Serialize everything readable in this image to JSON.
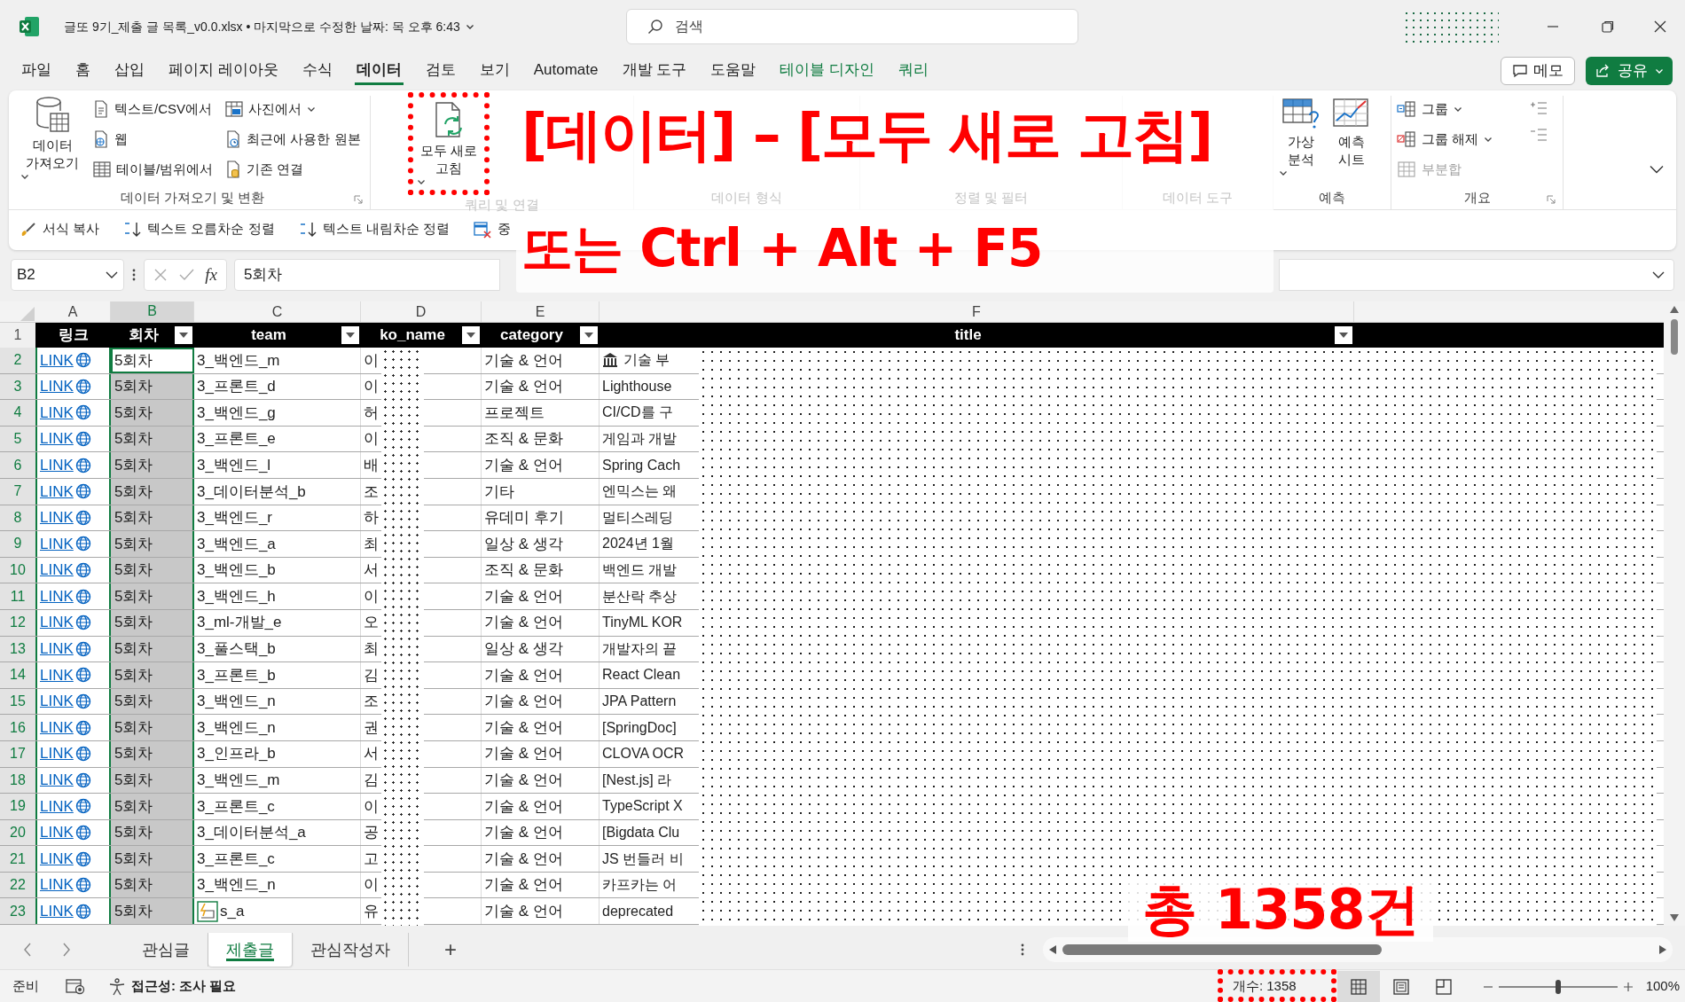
{
  "window": {
    "title": "글또 9기_제출 글 목록_v0.0.xlsx • 마지막으로 수정한 날짜: 목 오후 6:43",
    "search": {
      "placeholder": "검색"
    }
  },
  "menu_tabs": [
    {
      "label": "파일",
      "selected": false,
      "kind": "normal"
    },
    {
      "label": "홈",
      "selected": false,
      "kind": "normal"
    },
    {
      "label": "삽입",
      "selected": false,
      "kind": "normal"
    },
    {
      "label": "페이지 레이아웃",
      "selected": false,
      "kind": "normal"
    },
    {
      "label": "수식",
      "selected": false,
      "kind": "normal"
    },
    {
      "label": "데이터",
      "selected": true,
      "kind": "normal"
    },
    {
      "label": "검토",
      "selected": false,
      "kind": "normal"
    },
    {
      "label": "보기",
      "selected": false,
      "kind": "normal"
    },
    {
      "label": "Automate",
      "selected": false,
      "kind": "normal"
    },
    {
      "label": "개발 도구",
      "selected": false,
      "kind": "normal"
    },
    {
      "label": "도움말",
      "selected": false,
      "kind": "normal"
    },
    {
      "label": "테이블 디자인",
      "selected": false,
      "kind": "contextual"
    },
    {
      "label": "쿼리",
      "selected": false,
      "kind": "contextual"
    }
  ],
  "header_buttons": [
    {
      "label": "메모",
      "kind": "outline"
    },
    {
      "label": "공유",
      "kind": "primary"
    }
  ],
  "ribbon": {
    "groups": [
      {
        "label": "데이터 가져오기 및 변환",
        "faded": false,
        "items": [
          {
            "kind": "large",
            "label": "데이터 가져오기",
            "dropdown": true,
            "disabled": false
          },
          {
            "kind": "small",
            "label": "텍스트/CSV에서",
            "dropdown": false,
            "disabled": false
          },
          {
            "kind": "small",
            "label": "웹",
            "dropdown": false,
            "disabled": false
          },
          {
            "kind": "small",
            "label": "테이블/범위에서",
            "dropdown": false,
            "disabled": false
          },
          {
            "kind": "small",
            "label": "사진에서",
            "dropdown": true,
            "disabled": false
          },
          {
            "kind": "small",
            "label": "최근에 사용한 원본",
            "dropdown": false,
            "disabled": false
          },
          {
            "kind": "small",
            "label": "기존 연결",
            "dropdown": false,
            "disabled": false
          }
        ]
      },
      {
        "label": "쿼리 및 연결",
        "faded": true,
        "items": [
          {
            "kind": "large",
            "label": "모두 새로 고침",
            "dropdown": true,
            "disabled": false
          }
        ]
      },
      {
        "label": "데이터 형식",
        "faded": true
      },
      {
        "label": "정렬 및 필터",
        "faded": true
      },
      {
        "label": "데이터 도구",
        "faded": true
      },
      {
        "label": "예측",
        "faded": false,
        "items": [
          {
            "kind": "large",
            "label": "가상 분석",
            "dropdown": true,
            "disabled": false
          },
          {
            "kind": "large",
            "label": "예측 시트",
            "dropdown": false,
            "disabled": false
          }
        ]
      },
      {
        "label": "개요",
        "faded": false,
        "items": [
          {
            "kind": "small",
            "label": "그룹",
            "dropdown": true,
            "disabled": false
          },
          {
            "kind": "small",
            "label": "그룹 해제",
            "dropdown": true,
            "disabled": false
          },
          {
            "kind": "small",
            "label": "부분합",
            "dropdown": false,
            "disabled": true
          }
        ]
      }
    ]
  },
  "quick_toolbar": [
    {
      "label": "서식 복사"
    },
    {
      "label": "텍스트 오름차순 정렬"
    },
    {
      "label": "텍스트 내림차순 정렬"
    },
    {
      "label": "중"
    }
  ],
  "formula_bar": {
    "name_box": "B2",
    "function_label": "fx",
    "value": "5회차"
  },
  "columns": [
    {
      "letter": "A",
      "selected": false
    },
    {
      "letter": "B",
      "selected": true
    },
    {
      "letter": "C",
      "selected": false
    },
    {
      "letter": "D",
      "selected": false
    },
    {
      "letter": "E",
      "selected": false
    },
    {
      "letter": "F",
      "selected": false
    }
  ],
  "table": {
    "header_row_number": "1",
    "header": [
      {
        "label": "링크",
        "filter": false
      },
      {
        "label": "회차",
        "filter": true
      },
      {
        "label": "team",
        "filter": true
      },
      {
        "label": "ko_name",
        "filter": true
      },
      {
        "label": "category",
        "filter": true
      },
      {
        "label": "title",
        "filter": true
      }
    ],
    "rows": [
      {
        "number": "2",
        "link": "LINK",
        "round": "5회차",
        "team": "3_백엔드_m",
        "ko_name": "이",
        "category": "기술 & 언어",
        "title": "기술 부",
        "title_icon": true,
        "selected": true,
        "active": true
      },
      {
        "number": "3",
        "link": "LINK",
        "round": "5회차",
        "team": "3_프론트_d",
        "ko_name": "이",
        "category": "기술 & 언어",
        "title": "Lighthouse",
        "selected": true,
        "active": false
      },
      {
        "number": "4",
        "link": "LINK",
        "round": "5회차",
        "team": "3_백엔드_g",
        "ko_name": "허",
        "category": "프로젝트",
        "title": "CI/CD를 구",
        "selected": true,
        "active": false
      },
      {
        "number": "5",
        "link": "LINK",
        "round": "5회차",
        "team": "3_프론트_e",
        "ko_name": "이",
        "category": "조직 & 문화",
        "title": "게임과 개발",
        "selected": true,
        "active": false
      },
      {
        "number": "6",
        "link": "LINK",
        "round": "5회차",
        "team": "3_백엔드_l",
        "ko_name": "배",
        "category": "기술 & 언어",
        "title": "Spring Cach",
        "selected": true,
        "active": false
      },
      {
        "number": "7",
        "link": "LINK",
        "round": "5회차",
        "team": "3_데이터분석_b",
        "ko_name": "조",
        "category": "기타",
        "title": "엔믹스는 왜",
        "selected": true,
        "active": false
      },
      {
        "number": "8",
        "link": "LINK",
        "round": "5회차",
        "team": "3_백엔드_r",
        "ko_name": "하",
        "category": "유데미 후기",
        "title": "멀티스레딩",
        "selected": true,
        "active": false
      },
      {
        "number": "9",
        "link": "LINK",
        "round": "5회차",
        "team": "3_백엔드_a",
        "ko_name": "최",
        "category": "일상 & 생각",
        "title": "2024년 1월",
        "selected": true,
        "active": false
      },
      {
        "number": "10",
        "link": "LINK",
        "round": "5회차",
        "team": "3_백엔드_b",
        "ko_name": "서",
        "category": "조직 & 문화",
        "title": "백엔드 개발",
        "selected": true,
        "active": false
      },
      {
        "number": "11",
        "link": "LINK",
        "round": "5회차",
        "team": "3_백엔드_h",
        "ko_name": "이",
        "category": "기술 & 언어",
        "title": "분산락 추상",
        "selected": true,
        "active": false
      },
      {
        "number": "12",
        "link": "LINK",
        "round": "5회차",
        "team": "3_ml-개발_e",
        "ko_name": "오",
        "category": "기술 & 언어",
        "title": "TinyML KOR",
        "selected": true,
        "active": false
      },
      {
        "number": "13",
        "link": "LINK",
        "round": "5회차",
        "team": "3_풀스택_b",
        "ko_name": "최",
        "category": "일상 & 생각",
        "title": "개발자의 끝",
        "selected": true,
        "active": false
      },
      {
        "number": "14",
        "link": "LINK",
        "round": "5회차",
        "team": "3_프론트_b",
        "ko_name": "김",
        "category": "기술 & 언어",
        "title": "React Clean",
        "selected": true,
        "active": false
      },
      {
        "number": "15",
        "link": "LINK",
        "round": "5회차",
        "team": "3_백엔드_n",
        "ko_name": "조",
        "category": "기술 & 언어",
        "title": "JPA Pattern",
        "selected": true,
        "active": false
      },
      {
        "number": "16",
        "link": "LINK",
        "round": "5회차",
        "team": "3_백엔드_n",
        "ko_name": "권",
        "category": "기술 & 언어",
        "title": "[SpringDoc]",
        "selected": true,
        "active": false
      },
      {
        "number": "17",
        "link": "LINK",
        "round": "5회차",
        "team": "3_인프라_b",
        "ko_name": "서",
        "category": "기술 & 언어",
        "title": "CLOVA OCR",
        "selected": true,
        "active": false
      },
      {
        "number": "18",
        "link": "LINK",
        "round": "5회차",
        "team": "3_백엔드_m",
        "ko_name": "김",
        "category": "기술 & 언어",
        "title": "[Nest.js] 라",
        "selected": true,
        "active": false
      },
      {
        "number": "19",
        "link": "LINK",
        "round": "5회차",
        "team": "3_프론트_c",
        "ko_name": "이",
        "category": "기술 & 언어",
        "title": "TypeScript X",
        "selected": true,
        "active": false
      },
      {
        "number": "20",
        "link": "LINK",
        "round": "5회차",
        "team": "3_데이터분석_a",
        "ko_name": "공",
        "category": "기술 & 언어",
        "title": "[Bigdata Clu",
        "selected": true,
        "active": false
      },
      {
        "number": "21",
        "link": "LINK",
        "round": "5회차",
        "team": "3_프론트_c",
        "ko_name": "고",
        "category": "기술 & 언어",
        "title": "JS 번들러 비",
        "selected": true,
        "active": false
      },
      {
        "number": "22",
        "link": "LINK",
        "round": "5회차",
        "team": "3_백엔드_n",
        "ko_name": "이",
        "category": "기술 & 언어",
        "title": "카프카는 어",
        "selected": true,
        "active": false
      },
      {
        "number": "23",
        "link": "LINK",
        "round": "5회차",
        "team": "s_a",
        "quick_analysis_icon": true,
        "ko_name": "유",
        "category": "기술 & 언어",
        "title": "deprecated",
        "selected": true,
        "active": false
      }
    ]
  },
  "sheet_tabs": [
    {
      "label": "관심글",
      "selected": false
    },
    {
      "label": "제출글",
      "selected": true
    },
    {
      "label": "관심작성자",
      "selected": false
    }
  ],
  "add_sheet": "+",
  "status_bar": {
    "ready": "준비",
    "accessibility": "접근성: 조사 필요",
    "count": "개수: 1358",
    "views": [
      {
        "kind": "normal",
        "selected": true
      },
      {
        "kind": "page_layout",
        "selected": false
      },
      {
        "kind": "page_break",
        "selected": false
      }
    ],
    "zoom": {
      "level": 0.5,
      "reading": "100%"
    }
  },
  "annotations": [
    {
      "kind": "title",
      "text": "[데이터] – [모두 새로 고침]"
    },
    {
      "kind": "shortcut",
      "text": "또는 Ctrl + Alt + F5"
    },
    {
      "kind": "total",
      "text": "총 1358건"
    }
  ]
}
